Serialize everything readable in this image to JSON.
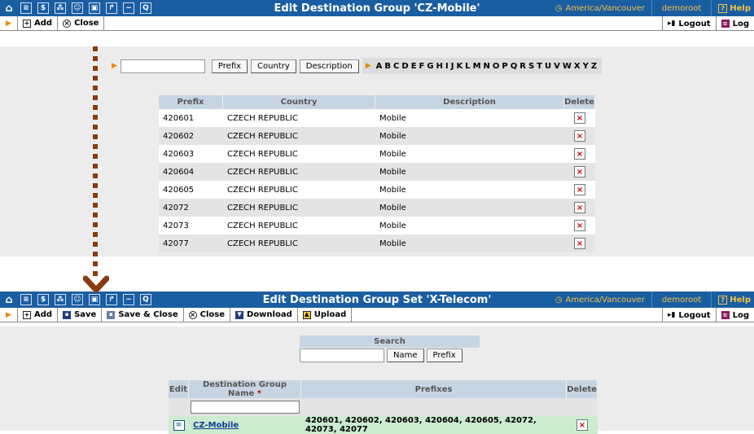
{
  "top1": {
    "title": "Edit Destination Group 'CZ-Mobile'",
    "timezone": "America/Vancouver",
    "user": "demoroot",
    "help": "Help"
  },
  "toolbar1": {
    "add": "Add",
    "close": "Close",
    "logout": "Logout",
    "log": "Log"
  },
  "filter": {
    "prefix_btn": "Prefix",
    "country_btn": "Country",
    "description_btn": "Description",
    "letters": [
      "A",
      "B",
      "C",
      "D",
      "E",
      "F",
      "G",
      "H",
      "I",
      "J",
      "K",
      "L",
      "M",
      "N",
      "O",
      "P",
      "Q",
      "R",
      "S",
      "T",
      "U",
      "V",
      "W",
      "X",
      "Y",
      "Z"
    ]
  },
  "table1": {
    "headers": [
      "Prefix",
      "Country",
      "Description",
      "Delete"
    ],
    "rows": [
      {
        "prefix": "420601",
        "country": "CZECH REPUBLIC",
        "description": "Mobile"
      },
      {
        "prefix": "420602",
        "country": "CZECH REPUBLIC",
        "description": "Mobile"
      },
      {
        "prefix": "420603",
        "country": "CZECH REPUBLIC",
        "description": "Mobile"
      },
      {
        "prefix": "420604",
        "country": "CZECH REPUBLIC",
        "description": "Mobile"
      },
      {
        "prefix": "420605",
        "country": "CZECH REPUBLIC",
        "description": "Mobile"
      },
      {
        "prefix": "42072",
        "country": "CZECH REPUBLIC",
        "description": "Mobile"
      },
      {
        "prefix": "42073",
        "country": "CZECH REPUBLIC",
        "description": "Mobile"
      },
      {
        "prefix": "42077",
        "country": "CZECH REPUBLIC",
        "description": "Mobile"
      }
    ]
  },
  "top2": {
    "title": "Edit Destination Group Set 'X-Telecom'",
    "timezone": "America/Vancouver",
    "user": "demoroot",
    "help": "Help"
  },
  "toolbar2": {
    "add": "Add",
    "save": "Save",
    "save_close": "Save & Close",
    "close": "Close",
    "download": "Download",
    "upload": "Upload",
    "logout": "Logout",
    "log": "Log"
  },
  "search": {
    "title": "Search",
    "name_btn": "Name",
    "prefix_btn": "Prefix"
  },
  "table2": {
    "headers": {
      "edit": "Edit",
      "name": "Destination Group Name",
      "required": "*",
      "prefixes": "Prefixes",
      "delete": "Delete"
    },
    "row": {
      "name": "CZ-Mobile",
      "prefixes": "420601, 420602, 420603, 420604, 420605, 42072, 42073, 42077"
    }
  },
  "colors": {
    "topbar": "#1a5ea2",
    "accent": "#e58a00",
    "header": "#c7d5e3",
    "highlight": "#ccebcf",
    "arrow": "#8b3a0f"
  }
}
